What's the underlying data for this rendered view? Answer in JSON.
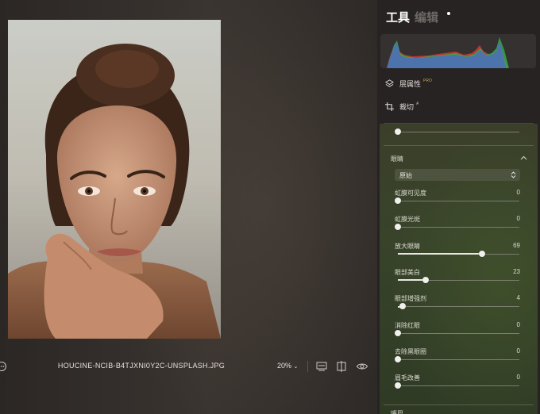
{
  "file": {
    "name": "HOUCINE-NCIB-B4TJXNI0Y2C-UNSPLASH.JPG"
  },
  "toolbar": {
    "zoom": "20%"
  },
  "tabs": [
    {
      "label": "工具",
      "active": true
    },
    {
      "label": "编辑",
      "active": false
    }
  ],
  "tools": [
    {
      "label": "层属性",
      "badge": "PRO"
    },
    {
      "label": "裁切",
      "badge": "A"
    }
  ],
  "eyes": {
    "title": "眼睛",
    "select_value": "原始",
    "sliders": [
      {
        "label": "虹膜可见度",
        "value": 0
      },
      {
        "label": "虹膜光斑",
        "value": 0
      },
      {
        "label": "放大眼睛",
        "value": 69
      },
      {
        "label": "眼部美白",
        "value": 23
      },
      {
        "label": "眼部增强剂",
        "value": 4
      },
      {
        "label": "消除红眼",
        "value": 0
      },
      {
        "label": "去除黑眼圈",
        "value": 0
      },
      {
        "label": "眉毛改善",
        "value": 0
      }
    ]
  },
  "next_section": {
    "title": "嘴巴"
  },
  "colors": {
    "accent_green": "#38432a",
    "histogram_blue": "#4d6fb8",
    "histogram_green": "#33b04a",
    "histogram_red": "#d43a2e",
    "pro_badge": "#c9a24a"
  },
  "icons": [
    "more-icon",
    "preview-icon",
    "compare-icon",
    "eye-icon",
    "layers-icon",
    "crop-icon",
    "chevron-up-icon",
    "select-arrows-icon"
  ]
}
